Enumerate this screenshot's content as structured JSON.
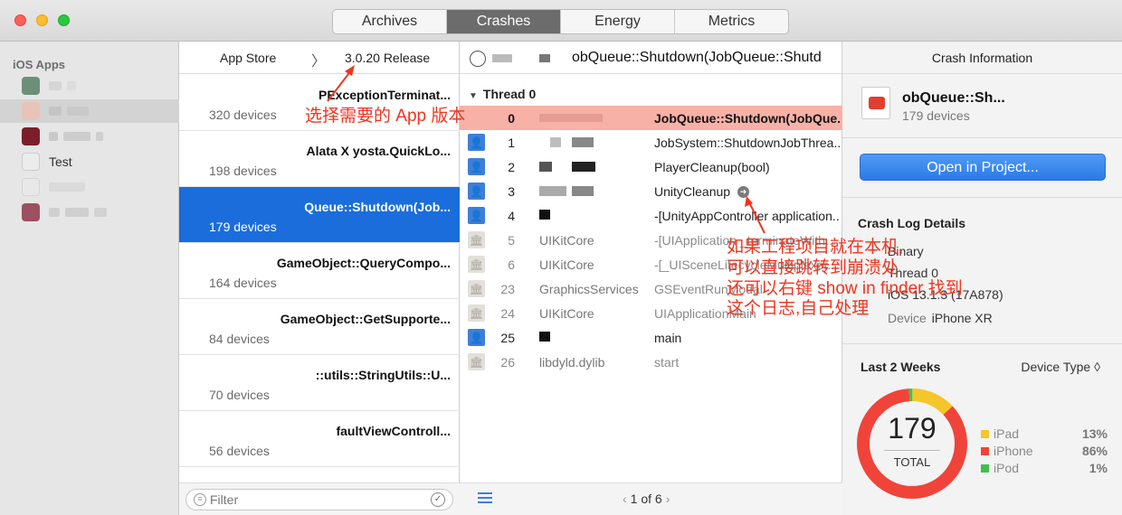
{
  "toolbar": {
    "tabs": [
      {
        "label": "Archives",
        "active": false
      },
      {
        "label": "Crashes",
        "active": true
      },
      {
        "label": "Energy",
        "active": false
      },
      {
        "label": "Metrics",
        "active": false
      }
    ]
  },
  "sidebar": {
    "heading": "iOS Apps",
    "apps": [
      {
        "label": "",
        "icon_color": "#6d8f7a"
      },
      {
        "label": "",
        "icon_color": "#e8c4b8"
      },
      {
        "label": "",
        "icon_color": "#7a1f28"
      },
      {
        "label": "Test",
        "icon_color": "#ececec"
      },
      {
        "label": "",
        "icon_color": "#e8e8e8"
      },
      {
        "label": "",
        "icon_color": "#9c5060"
      }
    ]
  },
  "crash_list": {
    "header_store": "App Store",
    "header_release": "3.0.20 Release",
    "items": [
      {
        "title": "PExceptionTerminat...",
        "devices": "320 devices"
      },
      {
        "title": "Alata    X yosta.QuickLo...",
        "devices": "198 devices"
      },
      {
        "title": "Queue::Shutdown(Job...",
        "devices": "179 devices",
        "selected": true
      },
      {
        "title": "GameObject::QueryCompo...",
        "devices": "164 devices"
      },
      {
        "title": "GameObject::GetSupporte...",
        "devices": "84 devices"
      },
      {
        "title": "::utils::StringUtils::U...",
        "devices": "70 devices"
      },
      {
        "title": "faultViewControll...",
        "devices": "56 devices"
      }
    ],
    "filter_placeholder": "Filter"
  },
  "trace": {
    "title": "obQueue::Shutdown(JobQueue::Shutd",
    "thread": "Thread 0",
    "frames": [
      {
        "num": "0",
        "lib": "",
        "sym": "JobQueue::Shutdown(JobQue...",
        "kind": "user",
        "style": "highlight"
      },
      {
        "num": "1",
        "lib": "",
        "sym": "JobSystem::ShutdownJobThrea...",
        "kind": "user",
        "style": ""
      },
      {
        "num": "2",
        "lib": "",
        "sym": "PlayerCleanup(bool)",
        "kind": "user",
        "style": ""
      },
      {
        "num": "3",
        "lib": "",
        "sym": "UnityCleanup",
        "kind": "user",
        "style": "",
        "jump": true
      },
      {
        "num": "4",
        "lib": "",
        "sym": "-[UnityAppController application...",
        "kind": "user",
        "style": ""
      },
      {
        "num": "5",
        "lib": "UIKitCore",
        "sym": "-[UIApplication _terminateWith...",
        "kind": "sys",
        "style": "dim"
      },
      {
        "num": "6",
        "lib": "UIKitCore",
        "sym": "-[_UISceneLifecycleMultiplexer...",
        "kind": "sys",
        "style": "dim"
      },
      {
        "num": "23",
        "lib": "GraphicsServices",
        "sym": "GSEventRunModal",
        "kind": "sys",
        "style": "dim"
      },
      {
        "num": "24",
        "lib": "UIKitCore",
        "sym": "UIApplicationMain",
        "kind": "sys",
        "style": "dim"
      },
      {
        "num": "25",
        "lib": "",
        "sym": "main",
        "kind": "user",
        "style": ""
      },
      {
        "num": "26",
        "lib": "libdyld.dylib",
        "sym": "start",
        "kind": "sys",
        "style": "dim"
      }
    ],
    "pager": "1 of 6"
  },
  "info": {
    "heading": "Crash Information",
    "title": "obQueue::Sh...",
    "devices": "179 devices",
    "open_button": "Open in Project...",
    "log_title": "Crash Log Details",
    "log_rows": [
      {
        "key": "",
        "value": "Binary"
      },
      {
        "key": "",
        "value": "Thread 0"
      },
      {
        "key": "",
        "value": "iOS 13.1.3 (17A878)"
      },
      {
        "key": "Device",
        "value": "iPhone XR"
      }
    ],
    "weeks_title": "Last 2 Weeks",
    "device_type": "Device Type ◊",
    "total_num": "179",
    "total_label": "TOTAL",
    "legend": [
      {
        "name": "iPad",
        "value": "13%",
        "color": "#f5c629"
      },
      {
        "name": "iPhone",
        "value": "86%",
        "color": "#f0443a"
      },
      {
        "name": "iPod",
        "value": "1%",
        "color": "#3dc24a"
      }
    ]
  },
  "annotations": {
    "version_note": "选择需要的 App 版本",
    "jump_note_1": "如果工程项目就在本机,",
    "jump_note_2": "可以直接跳转到崩溃处",
    "jump_note_3": "还可以右键 show in finder 找到",
    "jump_note_4": "这个日志,自己处理"
  }
}
